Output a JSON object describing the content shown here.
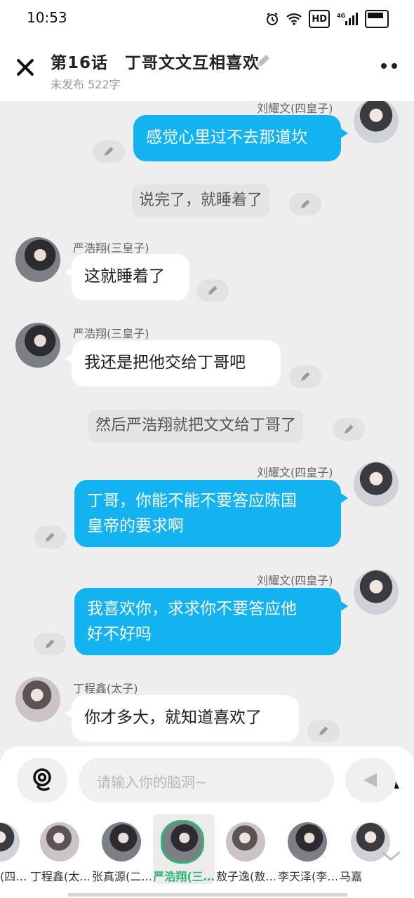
{
  "status_bar": {
    "time": "10:53",
    "hd": "HD",
    "network": "4G"
  },
  "header": {
    "title": "第16话　丁哥文文互相喜欢",
    "subtitle": "未发布 522字"
  },
  "messages": [
    {
      "name": "刘耀文(四皇子)",
      "text": "感觉心里过不去那道坎"
    },
    {
      "narration": "说完了，就睡着了"
    },
    {
      "name": "严浩翔(三皇子)",
      "text": "这就睡着了"
    },
    {
      "name": "严浩翔(三皇子)",
      "text": "我还是把他交给丁哥吧"
    },
    {
      "narration": "然后严浩翔就把文文给丁哥了"
    },
    {
      "name": "刘耀文(四皇子)",
      "text_line1": "丁哥，你能不能不要答应陈国",
      "text_line2": "皇帝的要求啊"
    },
    {
      "name": "刘耀文(四皇子)",
      "text_line1": "我喜欢你，求求你不要答应他",
      "text_line2": "好不好吗"
    },
    {
      "name": "丁程鑫(太子)",
      "text": "你才多大，就知道喜欢了"
    }
  ],
  "composer": {
    "placeholder": "请输入你的脑洞~"
  },
  "characters": [
    {
      "label": "(四…"
    },
    {
      "label": "丁程鑫(太…"
    },
    {
      "label": "张真源(二…"
    },
    {
      "label": "严浩翔(三…"
    },
    {
      "label": "敖子逸(敖…"
    },
    {
      "label": "李天泽(李…"
    },
    {
      "label": "马嘉"
    }
  ],
  "colors": {
    "accent_blue": "#12b3f0",
    "active_green": "#2fb67a"
  }
}
